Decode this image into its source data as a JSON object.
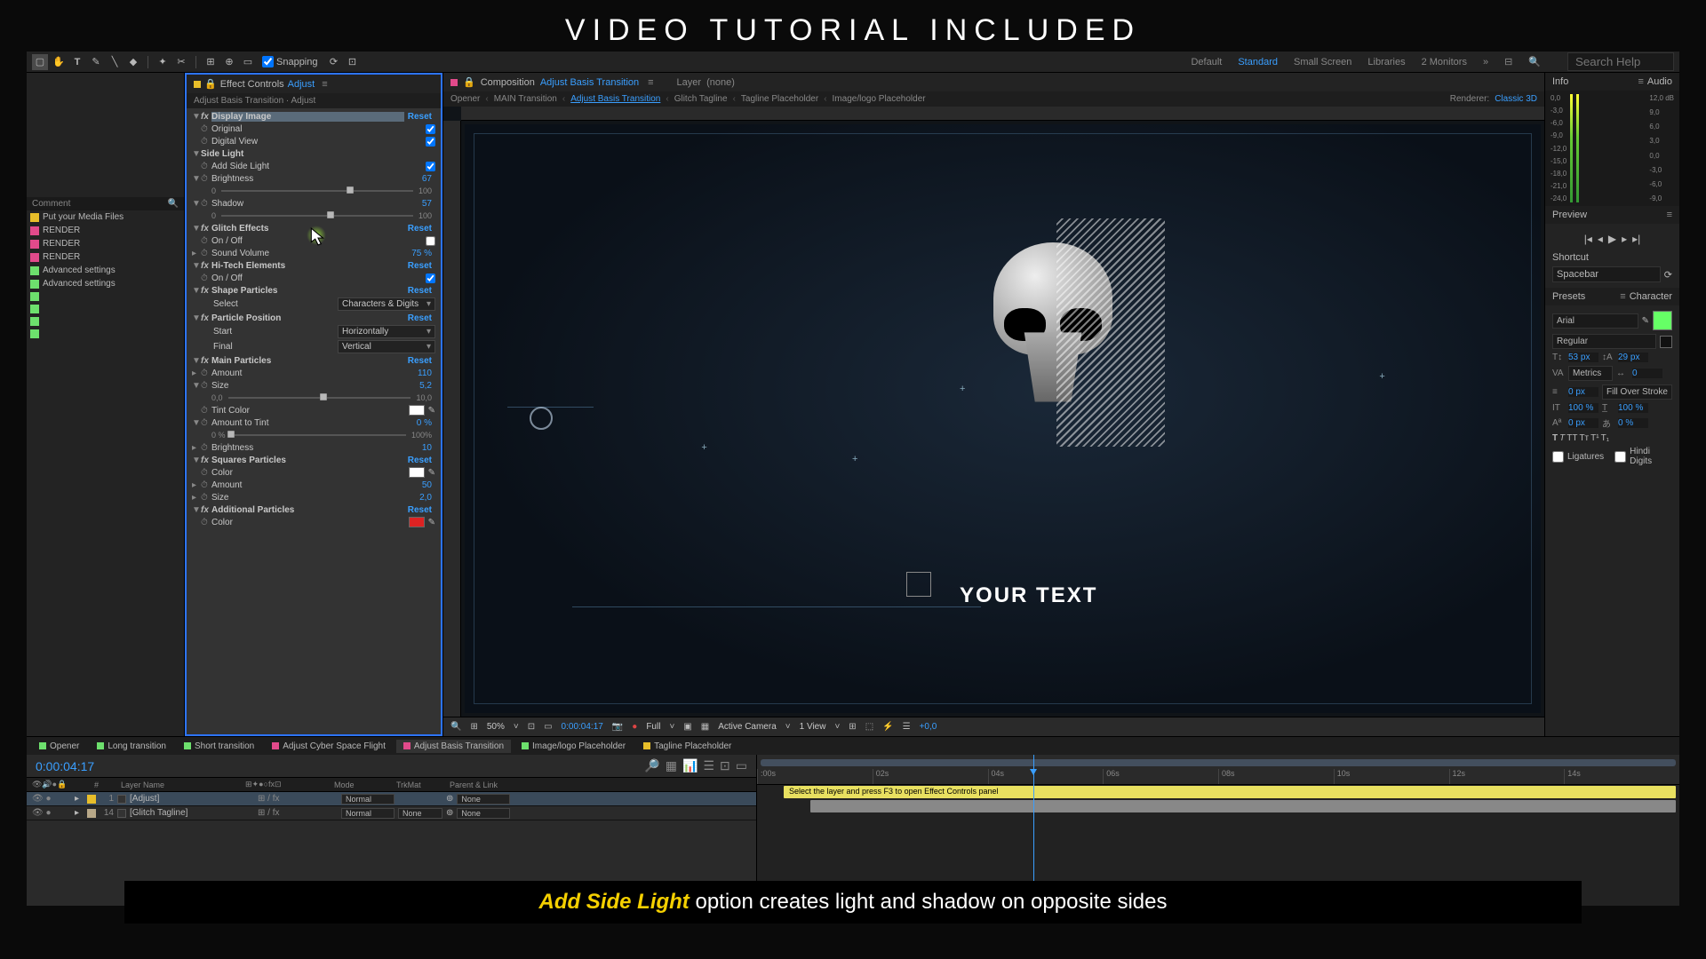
{
  "hero": "VIDEO TUTORIAL INCLUDED",
  "toolbar": {
    "snapping": "Snapping"
  },
  "workspaces": {
    "default": "Default",
    "standard": "Standard",
    "small": "Small Screen",
    "libraries": "Libraries",
    "monitors": "2 Monitors",
    "search_ph": "Search Help"
  },
  "project": {
    "comment_hdr": "Comment",
    "items": [
      {
        "color": "#e8be2a",
        "label": "Put your Media Files"
      },
      {
        "color": "#e24a8b",
        "label": "RENDER"
      },
      {
        "color": "#e24a8b",
        "label": "RENDER"
      },
      {
        "color": "#e24a8b",
        "label": "RENDER"
      },
      {
        "color": "#6de06d",
        "label": "Advanced settings"
      },
      {
        "color": "#6de06d",
        "label": "Advanced settings"
      },
      {
        "color": "#6de06d",
        "label": ""
      },
      {
        "color": "#6de06d",
        "label": ""
      },
      {
        "color": "#6de06d",
        "label": ""
      },
      {
        "color": "#6de06d",
        "label": ""
      }
    ]
  },
  "effectTab": {
    "title": "Effect Controls",
    "sub": "Adjust",
    "crumb": "Adjust Basis Transition · Adjust"
  },
  "fx": {
    "display": {
      "name": "Display Image",
      "reset": "Reset",
      "original": "Original",
      "digital": "Digital View"
    },
    "sidelight": {
      "name": "Side Light",
      "add": "Add Side Light",
      "bright": "Brightness",
      "bright_v": "67",
      "min": "0",
      "max": "100"
    },
    "shadow": {
      "name": "Shadow",
      "v": "57",
      "min": "0",
      "max": "100"
    },
    "glitch": {
      "name": "Glitch Effects",
      "reset": "Reset",
      "onoff": "On / Off",
      "sound": "Sound Volume",
      "sound_v": "75 %"
    },
    "hitech": {
      "name": "Hi-Tech Elements",
      "reset": "Reset",
      "onoff": "On / Off"
    },
    "shapep": {
      "name": "Shape Particles",
      "reset": "Reset",
      "select": "Select",
      "select_v": "Characters & Digits"
    },
    "ppos": {
      "name": "Particle Position",
      "reset": "Reset",
      "start": "Start",
      "start_v": "Horizontally",
      "final": "Final",
      "final_v": "Vertical"
    },
    "mainp": {
      "name": "Main Particles",
      "reset": "Reset",
      "amount": "Amount",
      "amount_v": "110",
      "size": "Size",
      "size_v": "5,2",
      "min": "0,0",
      "max": "10,0",
      "tint": "Tint Color",
      "att": "Amount to Tint",
      "att_v": "0 %",
      "att_min": "0 %",
      "att_max": "100%",
      "bright": "Brightness",
      "bright_v": "10"
    },
    "squares": {
      "name": "Squares Particles",
      "reset": "Reset",
      "color": "Color",
      "amount": "Amount",
      "amount_v": "50",
      "size": "Size",
      "size_v": "2,0"
    },
    "addp": {
      "name": "Additional Particles",
      "reset": "Reset",
      "color": "Color"
    }
  },
  "comp": {
    "tab": "Composition",
    "tab_v": "Adjust Basis Transition",
    "layer_tab": "Layer",
    "layer_v": "(none)",
    "crumbs": [
      "Opener",
      "MAIN Transition",
      "Adjust Basis Transition",
      "Glitch Tagline",
      "Tagline Placeholder",
      "Image/logo Placeholder"
    ],
    "renderer_lbl": "Renderer:",
    "renderer_v": "Classic 3D",
    "your_text": "YOUR TEXT"
  },
  "footer": {
    "zoom": "50%",
    "time": "0:00:04:17",
    "res": "Full",
    "cam": "Active Camera",
    "view": "1 View",
    "exp": "+0,0"
  },
  "right": {
    "info": "Info",
    "audio": "Audio",
    "db": [
      "0,0",
      "-3,0",
      "-6,0",
      "-9,0",
      "-12,0",
      "-15,0",
      "-18,0",
      "-21,0",
      "-24,0"
    ],
    "db_r": [
      "12,0 dB",
      "9,0",
      "6,0",
      "3,0",
      "0,0",
      "-3,0",
      "-6,0",
      "-9,0"
    ],
    "preview": "Preview",
    "shortcut": "Shortcut",
    "spacebar": "Spacebar",
    "presets": "Presets",
    "character": "Character",
    "font": "Arial",
    "style": "Regular",
    "fs": "53 px",
    "lh": "29 px",
    "va": "Metrics",
    "tr": "0",
    "stroke": "0 px",
    "fill": "Fill Over Stroke",
    "sv": "100 %",
    "sh": "100 %",
    "bl": "0 px",
    "ts": "0 %",
    "lig": "Ligatures",
    "hindi": "Hindi Digits"
  },
  "timeline": {
    "tabs": [
      {
        "color": "#6de06d",
        "label": "Opener"
      },
      {
        "color": "#6de06d",
        "label": "Long transition"
      },
      {
        "color": "#6de06d",
        "label": "Short transition"
      },
      {
        "color": "#e24a8b",
        "label": "Adjust Cyber Space Flight"
      },
      {
        "color": "#e24a8b",
        "label": "Adjust Basis Transition",
        "active": true
      },
      {
        "color": "#6de06d",
        "label": "Image/logo Placeholder"
      },
      {
        "color": "#e8be2a",
        "label": "Tagline Placeholder"
      }
    ],
    "time": "0:00:04:17",
    "col_layer": "Layer Name",
    "col_trk": "TrkMat",
    "col_mode": "Mode",
    "col_parent": "Parent & Link",
    "layer1": {
      "num": "1",
      "name": "[Adjust]",
      "mode": "Normal",
      "trk": "",
      "parent": "None"
    },
    "layer2": {
      "num": "14",
      "name": "[Glitch Tagline]",
      "mode": "Normal",
      "trk": "None",
      "parent": "None"
    },
    "bar_hint": "Select the layer and press F3 to open Effect Controls panel",
    "ticks": [
      ":00s",
      "02s",
      "04s",
      "06s",
      "08s",
      "10s",
      "12s",
      "14s"
    ]
  },
  "caption": {
    "hl": "Add Side Light",
    "rest": " option creates light and shadow on opposite sides"
  }
}
